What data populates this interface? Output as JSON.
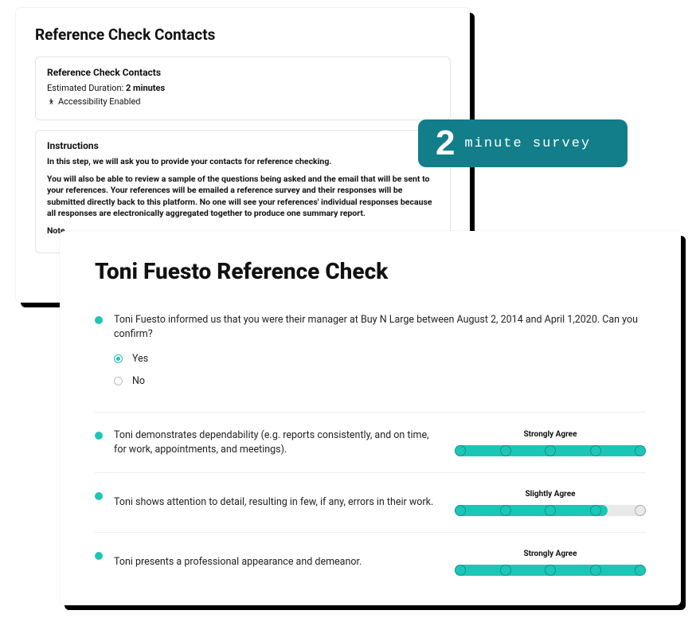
{
  "back": {
    "title": "Reference Check Contacts",
    "box1": {
      "title": "Reference Check Contacts",
      "duration_label": "Estimated Duration:",
      "duration_value": "2 minutes",
      "accessibility": "Accessibility Enabled"
    },
    "box2": {
      "title": "Instructions",
      "p1": "In this step, we will ask you to provide your contacts for reference checking.",
      "p2": "You will also be able to review a sample of the questions being asked and the email that will be sent to your references. Your references will be emailed a reference survey and their responses will be submitted directly back to this platform. No one will see your references' individual responses because all responses are electronically aggregated together to produce one summary report.",
      "note": "Note"
    }
  },
  "badge": {
    "num": "2",
    "text": "minute survey"
  },
  "front": {
    "title": "Toni Fuesto Reference Check",
    "q1": {
      "text": "Toni Fuesto informed us that you were their manager at Buy N Large between August 2, 2014 and April 1,2020. Can you confirm?",
      "yes": "Yes",
      "no": "No"
    },
    "q2": {
      "text": "Toni demonstrates dependability (e.g. reports consistently, and on time, for work, appointments, and meetings).",
      "scale_label": "Strongly Agree"
    },
    "q3": {
      "text": "Toni shows attention to detail, resulting in few, if any, errors in their work.",
      "scale_label": "Slightly Agree"
    },
    "q4": {
      "text": "Toni presents a professional appearance and demeanor.",
      "scale_label": "Strongly Agree"
    }
  }
}
